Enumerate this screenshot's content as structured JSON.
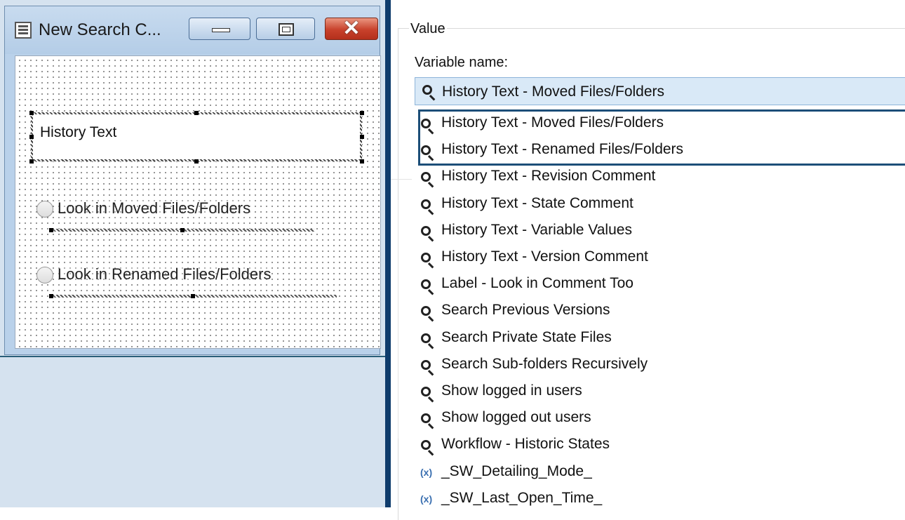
{
  "designer": {
    "title": "New Search C...",
    "controls": {
      "minimize": "minimize",
      "maximize": "maximize",
      "close": "✕"
    },
    "textbox_text": "History Text",
    "radio_1": "Look in Moved Files/Folders",
    "radio_2": "Look in Renamed Files/Folders"
  },
  "properties": {
    "group_label": "Value",
    "variable_label": "Variable name:",
    "selected_value": "History Text - Moved Files/Folders",
    "options": [
      {
        "icon": "search-icon",
        "label": "History Text - Moved Files/Folders"
      },
      {
        "icon": "search-icon",
        "label": "History Text - Renamed Files/Folders"
      },
      {
        "icon": "search-icon",
        "label": "History Text - Revision Comment"
      },
      {
        "icon": "search-icon",
        "label": "History Text - State Comment"
      },
      {
        "icon": "search-icon",
        "label": "History Text - Variable Values"
      },
      {
        "icon": "search-icon",
        "label": "History Text - Version Comment"
      },
      {
        "icon": "search-icon",
        "label": "Label - Look in Comment Too"
      },
      {
        "icon": "search-icon",
        "label": "Search Previous Versions"
      },
      {
        "icon": "search-icon",
        "label": "Search Private State Files"
      },
      {
        "icon": "search-icon",
        "label": "Search Sub-folders Recursively"
      },
      {
        "icon": "search-icon",
        "label": "Show logged in users"
      },
      {
        "icon": "search-icon",
        "label": "Show logged out users"
      },
      {
        "icon": "search-icon",
        "label": "Workflow - Historic States"
      },
      {
        "icon": "variable-icon",
        "label": "_SW_Detailing_Mode_"
      },
      {
        "icon": "variable-icon",
        "label": "_SW_Last_Open_Time_"
      }
    ],
    "variable_glyph": "(x)"
  },
  "colors": {
    "highlight_border": "#1c4e78",
    "splitter": "#0f3c6c",
    "combo_fill": "#d9e9f7"
  }
}
